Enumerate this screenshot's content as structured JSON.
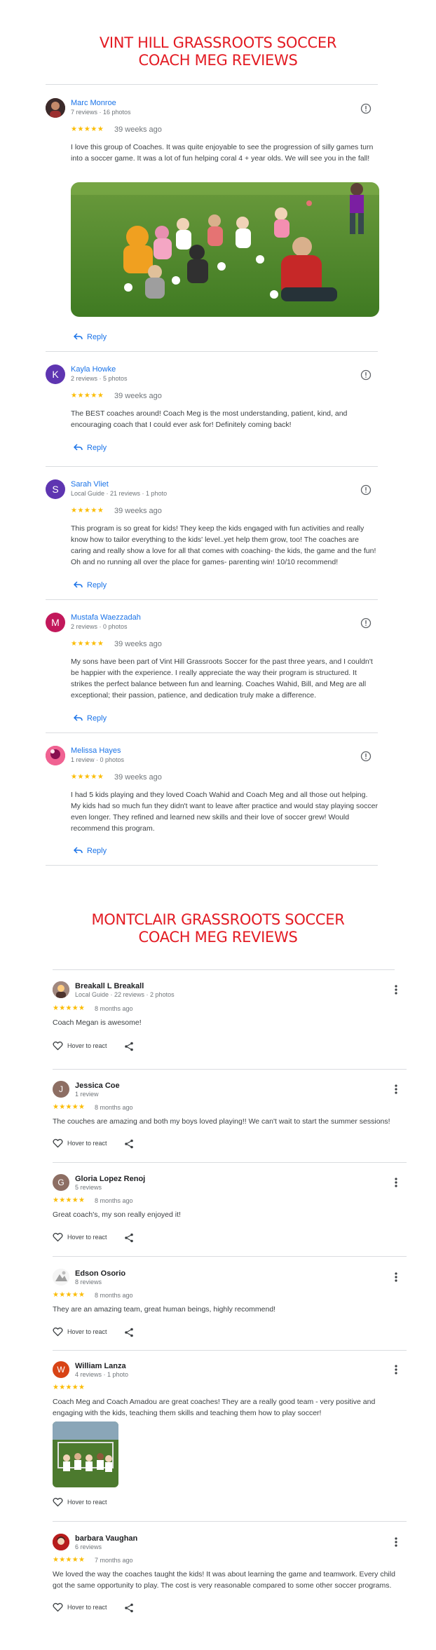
{
  "section1": {
    "title_line1": "VINT HILL GRASSROOTS SOCCER",
    "title_line2": "COACH MEG REVIEWS",
    "reviews": [
      {
        "name": "Marc Monroe",
        "meta": "7 reviews · 16 photos",
        "stars": "★★★★★",
        "date": "39 weeks ago",
        "text": "I love this group of Coaches. It was quite enjoyable to see the progression of silly games turn into a soccer game. It was a lot of fun helping coral 4 + year olds. We will see you in the fall!",
        "reply": "Reply"
      },
      {
        "name": "Kayla Howke",
        "initial": "K",
        "meta": "2 reviews · 5 photos",
        "stars": "★★★★★",
        "date": "39 weeks ago",
        "text": "The BEST coaches around! Coach Meg is the most understanding, patient, kind, and encouraging coach that I could ever ask for! Definitely coming back!",
        "reply": "Reply"
      },
      {
        "name": "Sarah Vliet",
        "initial": "S",
        "meta": "Local Guide · 21 reviews · 1 photo",
        "stars": "★★★★★",
        "date": "39 weeks ago",
        "text": "This program is so great for kids! They keep the kids engaged with fun activities and really know how to tailor everything to the kids' level..yet help them grow, too! The coaches are caring and really show a love for all that comes with coaching- the kids, the game and the fun! Oh and no running all over the place for games- parenting win! 10/10 recommend!",
        "reply": "Reply"
      },
      {
        "name": "Mustafa Waezzadah",
        "initial": "M",
        "meta": "2 reviews · 0 photos",
        "stars": "★★★★★",
        "date": "39 weeks ago",
        "text": "My sons have been part of Vint Hill Grassroots Soccer for the past three years, and I couldn't be happier with the experience. I really appreciate the way their program is structured. It strikes the perfect balance between fun and learning. Coaches Wahid, Bill, and Meg are all exceptional; their passion, patience, and dedication truly make a difference.",
        "reply": "Reply"
      },
      {
        "name": "Melissa Hayes",
        "meta": "1 review · 0 photos",
        "stars": "★★★★★",
        "date": "39 weeks ago",
        "text": "I had 5 kids playing and they loved Coach Wahid and Coach Meg and all those out helping. My kids had so much fun they didn't want to leave after practice and would stay playing soccer even longer. They refined and learned new skills and their love of soccer grew! Would recommend this program.",
        "reply": "Reply"
      }
    ]
  },
  "section2": {
    "title_line1": "MONTCLAIR GRASSROOTS SOCCER",
    "title_line2": "COACH MEG REVIEWS",
    "react_label": "Hover to react",
    "reviews": [
      {
        "name": "Breakall L Breakall",
        "meta": "Local Guide · 22 reviews · 2 photos",
        "stars": "★★★★★",
        "date": "8 months ago",
        "text": "Coach Megan is awesome!"
      },
      {
        "name": "Jessica Coe",
        "initial": "J",
        "meta": "1 review",
        "stars": "★★★★★",
        "date": "8 months ago",
        "text": "The couches are amazing and both my boys loved playing!! We can't wait to start the summer sessions!"
      },
      {
        "name": "Gloria Lopez Renoj",
        "initial": "G",
        "meta": "5 reviews",
        "stars": "★★★★★",
        "date": "8 months ago",
        "text": "Great coach's, my son really enjoyed it!"
      },
      {
        "name": "Edson Osorio",
        "meta": "8 reviews",
        "stars": "★★★★★",
        "date": "8 months ago",
        "text": "They are an amazing team, great human beings, highly recommend!"
      },
      {
        "name": "William Lanza",
        "initial": "W",
        "meta": "4 reviews · 1 photo",
        "stars": "★★★★★",
        "text": "Coach Meg and Coach Amadou are great coaches! They are a really good team - very positive and engaging with the kids, teaching them skills and teaching them how to play soccer!"
      },
      {
        "name": "barbara Vaughan",
        "meta": "6 reviews",
        "stars": "★★★★★",
        "date": "7 months ago",
        "text": "We loved the way the coaches taught the kids! It was about learning the game and teamwork. Every child got the same opportunity to play. The cost is very reasonable compared to some other soccer programs."
      }
    ]
  },
  "colors": {
    "title_red": "#e31b23",
    "link_blue": "#1a73e8",
    "star_gold": "#fbbc04",
    "avatar_kayla": "#5e35b1",
    "avatar_sarah": "#5e35b1",
    "avatar_mustafa": "#c2185b",
    "avatar_jessica": "#8d6e63",
    "avatar_gloria": "#8d6e63",
    "avatar_william": "#d84315"
  }
}
